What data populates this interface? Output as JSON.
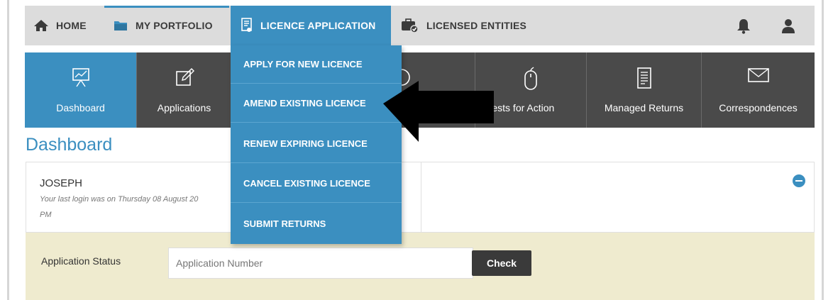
{
  "nav": {
    "home": "HOME",
    "portfolio": "MY PORTFOLIO",
    "licence_application": "LICENCE APPLICATION",
    "licensed_entities": "LICENSED ENTITIES"
  },
  "tiles": [
    {
      "label": "Dashboard",
      "icon": "presentation-chart-icon"
    },
    {
      "label": "Applications",
      "icon": "edit-icon"
    },
    {
      "label": "",
      "icon": "dollar-icon"
    },
    {
      "label": "Requests for Action",
      "icon": "mouse-icon"
    },
    {
      "label": "Managed Returns",
      "icon": "document-icon"
    },
    {
      "label": "Correspondences",
      "icon": "envelope-icon"
    }
  ],
  "visible_tile_text": {
    "requests": "equests for Action"
  },
  "page_title": "Dashboard",
  "welcome": {
    "name": "JOSEPH",
    "last_login": "Your last login was on Thursday 08 August 20",
    "last_login_cont": "PM"
  },
  "status": {
    "label": "Application Status",
    "placeholder": "Application Number",
    "check": "Check"
  },
  "dropdown": [
    "APPLY FOR NEW LICENCE",
    "AMEND EXISTING LICENCE",
    "RENEW EXPIRING LICENCE",
    "CANCEL EXISTING LICENCE",
    "SUBMIT RETURNS"
  ],
  "colors": {
    "accent": "#3b8fc0",
    "tile_dark": "#4a4a4a",
    "nav_bg": "#dcdcdc",
    "status_bg": "#efebcf"
  }
}
